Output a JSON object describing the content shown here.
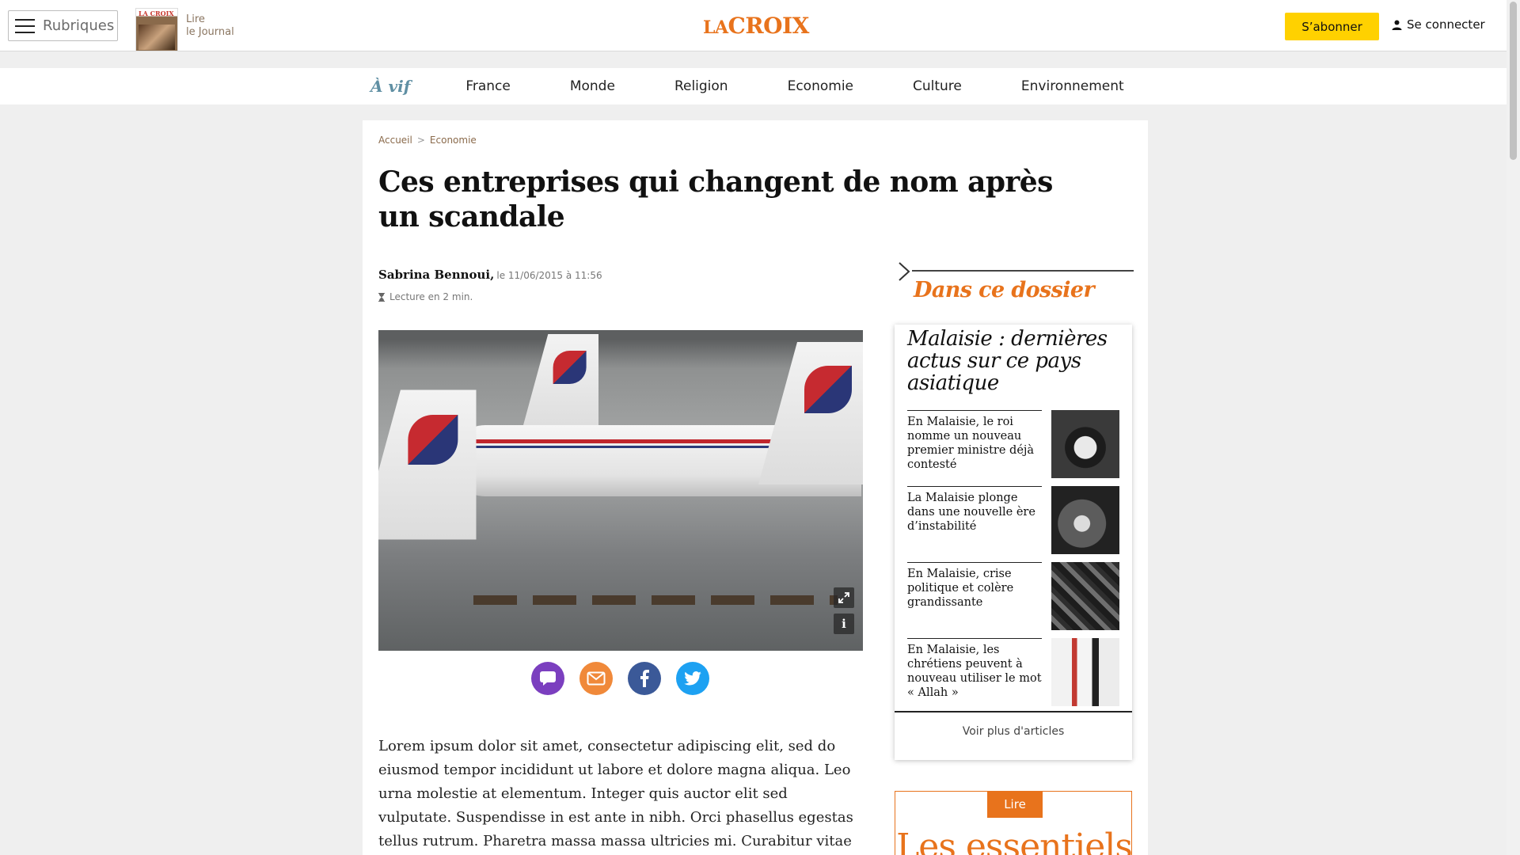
{
  "header": {
    "menu_label": "Rubriques",
    "journal_line1": "Lire",
    "journal_line2": "le Journal",
    "journal_thumb_logo": "LA CROIX",
    "brand_la": "LA",
    "brand_croix": "CROIX",
    "subscribe_label": "S’abonner",
    "login_label": "Se connecter"
  },
  "nav": {
    "vif_label": "À vif",
    "items": [
      "France",
      "Monde",
      "Religion",
      "Economie",
      "Culture",
      "Environnement"
    ]
  },
  "breadcrumb": {
    "home": "Accueil",
    "separator": ">",
    "section": "Economie"
  },
  "article": {
    "title": "Ces entreprises qui changent de nom après un scandale",
    "author": "Sabrina Bennoui,",
    "date": "le 11/06/2015 à 11:56",
    "read_time": "Lecture en 2 min.",
    "hero_info": "i",
    "body": "Lorem ipsum dolor sit amet, consectetur adipiscing elit, sed do eiusmod tempor incididunt ut labore et dolore magna aliqua. Leo urna molestie at elementum. Integer quis auctor elit sed vulputate. Suspendisse in est ante in nibh. Orci phasellus egestas tellus rutrum. Pharetra massa massa ultricies mi. Curabitur vitae nunc sed velit"
  },
  "share": [
    "comment-icon",
    "mail-icon",
    "facebook-icon",
    "twitter-icon"
  ],
  "dossier": {
    "heading": "Dans ce dossier",
    "title": "Malaisie : dernières actus sur ce pays asiatique",
    "items": [
      {
        "text": "En Malaisie, le roi nomme un nouveau premier ministre déjà contesté"
      },
      {
        "text": "La Malaisie plonge dans une nouvelle ère d’instabilité"
      },
      {
        "text": "En Malaisie, crise politique et colère grandissante"
      },
      {
        "text": "En Malaisie, les chrétiens peuvent à nouveau utiliser le mot « Allah »"
      }
    ],
    "more_label": "Voir plus d'articles"
  },
  "essentiels": {
    "tag": "Lire",
    "title": "Les essentiels"
  },
  "colors": {
    "brand_orange": "#e8731c",
    "subscribe_yellow": "#ffd100",
    "vif_blue": "#5f8fa3"
  }
}
